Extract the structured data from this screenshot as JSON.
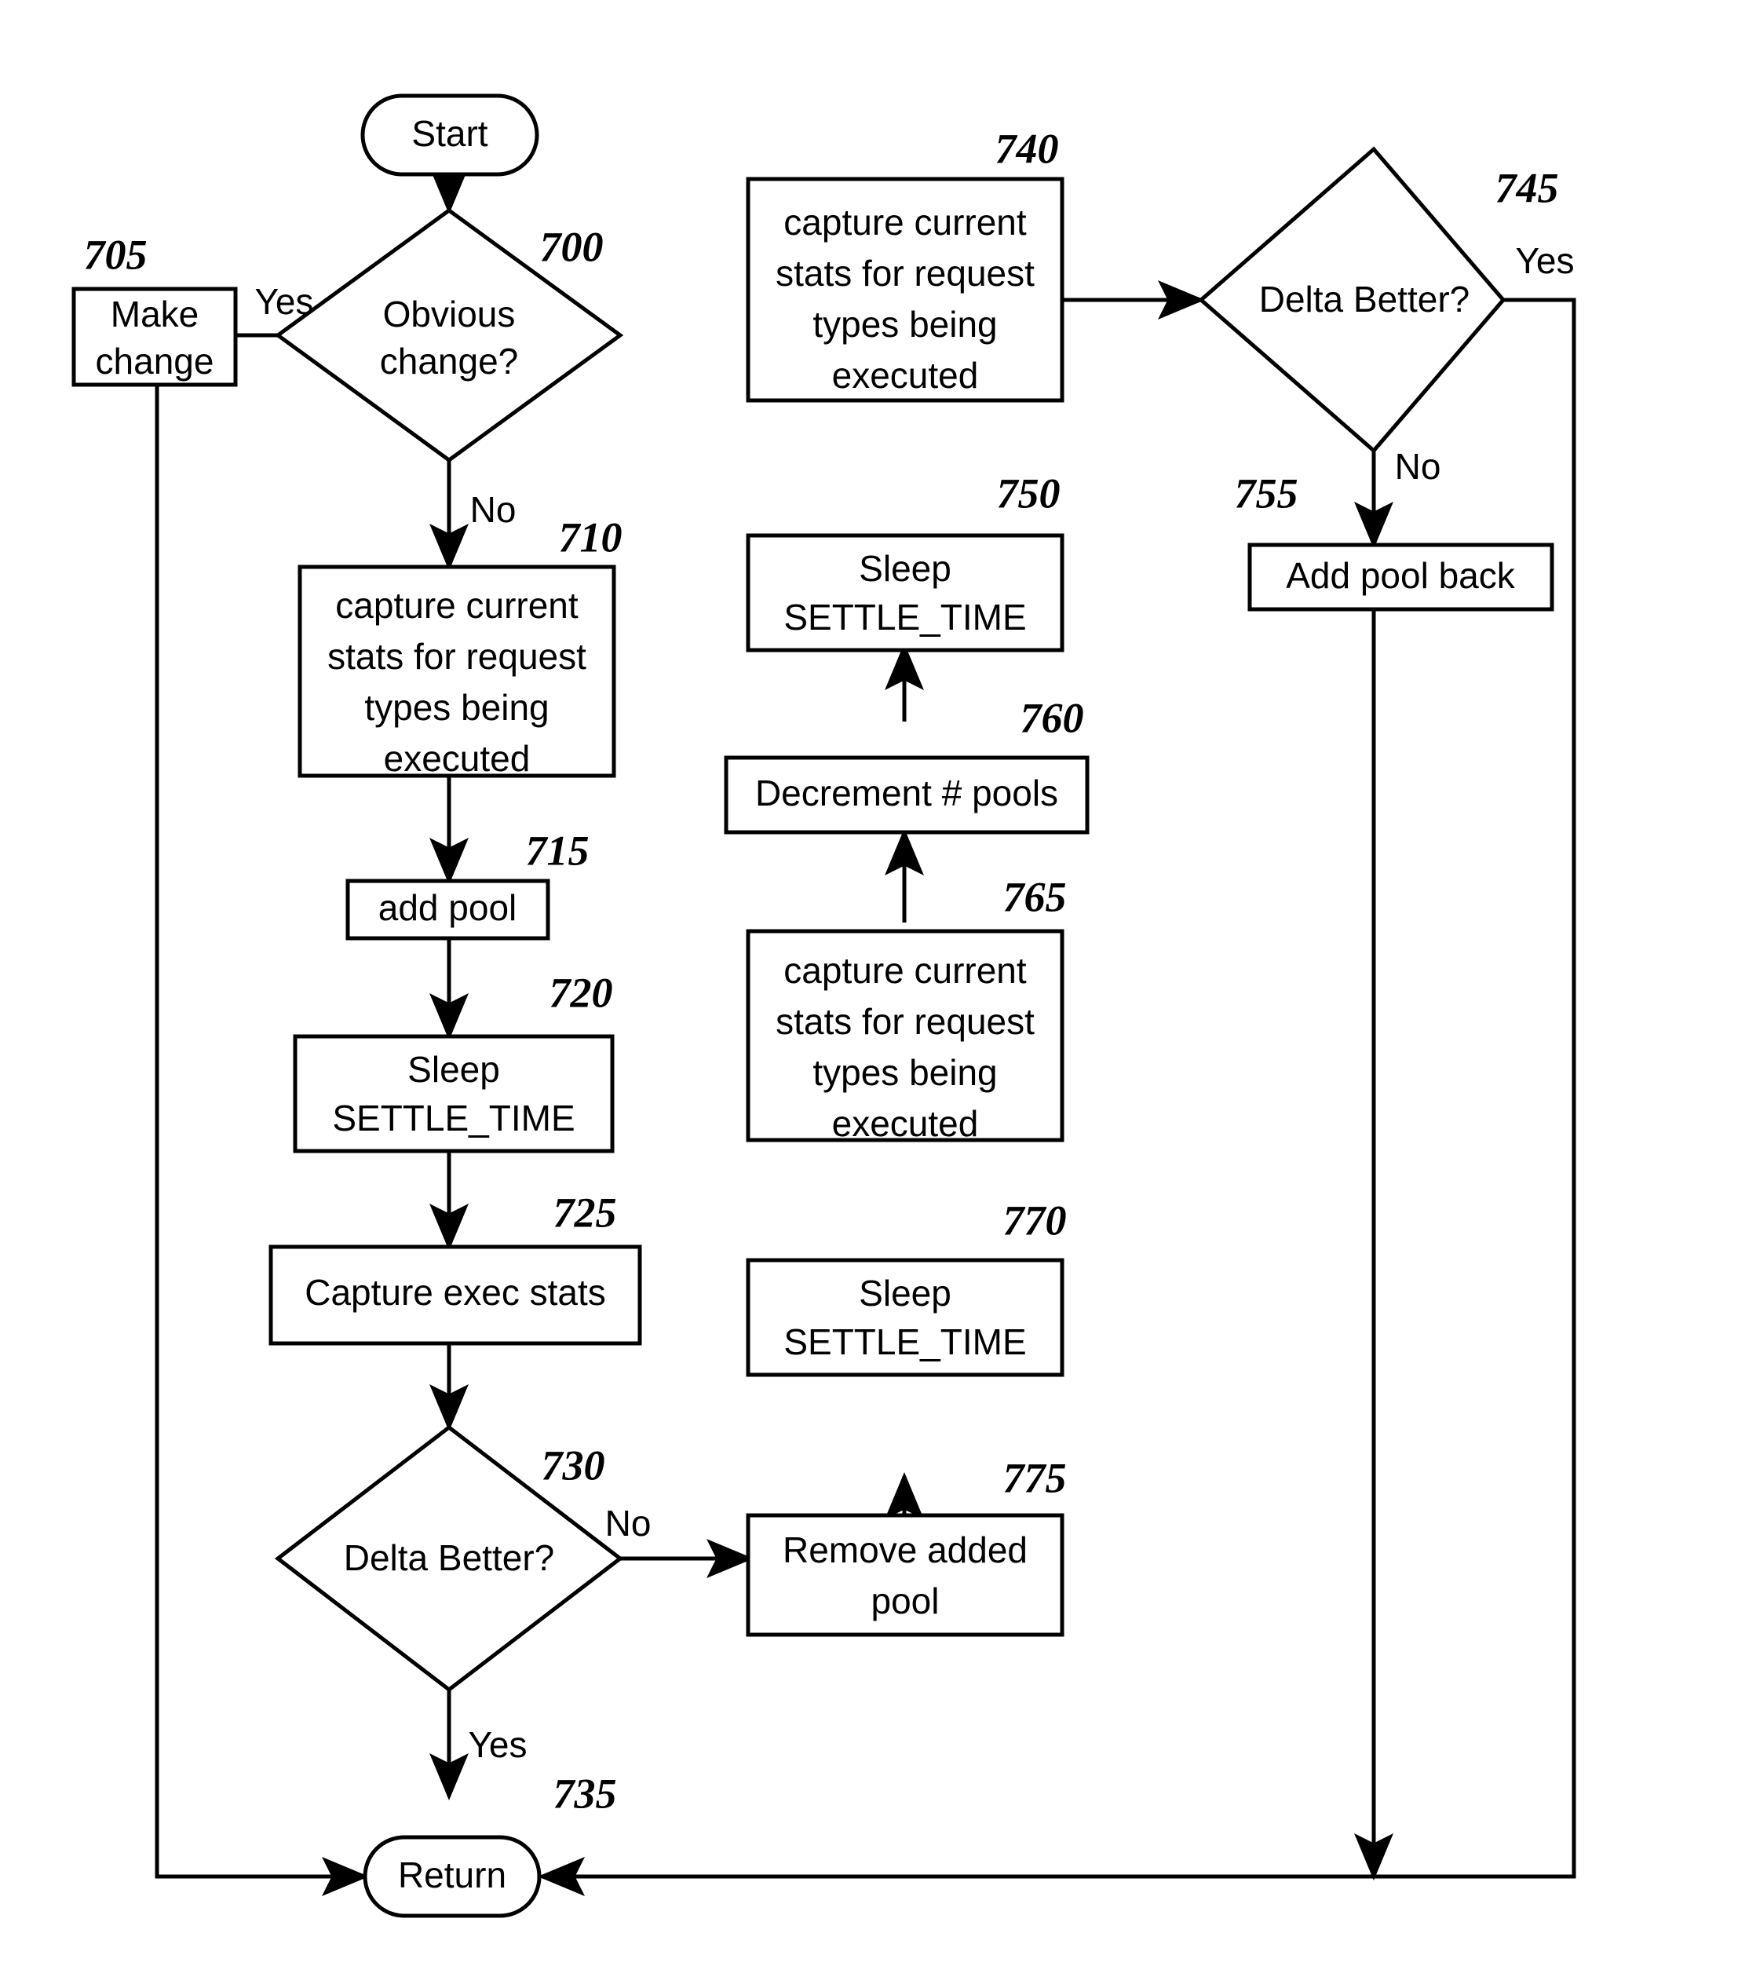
{
  "diagram": {
    "title": "Pool tuning flowchart",
    "stroke_color": "#000000",
    "fill_color": "#ffffff",
    "nodes": [
      {
        "id": "start",
        "ref": "",
        "shape": "terminator",
        "lines": [
          "Start"
        ]
      },
      {
        "id": "n700",
        "ref": "700",
        "shape": "decision",
        "lines": [
          "Obvious",
          "change?"
        ]
      },
      {
        "id": "n705",
        "ref": "705",
        "shape": "process",
        "lines": [
          "Make",
          "change"
        ]
      },
      {
        "id": "n710",
        "ref": "710",
        "shape": "process",
        "lines": [
          "capture current",
          "stats for request",
          "types being",
          "executed"
        ]
      },
      {
        "id": "n715",
        "ref": "715",
        "shape": "process",
        "lines": [
          "add pool"
        ]
      },
      {
        "id": "n720",
        "ref": "720",
        "shape": "process",
        "lines": [
          "Sleep",
          "SETTLE_TIME"
        ]
      },
      {
        "id": "n725",
        "ref": "725",
        "shape": "process",
        "lines": [
          "Capture exec stats"
        ]
      },
      {
        "id": "n730",
        "ref": "730",
        "shape": "decision",
        "lines": [
          "Delta Better?"
        ]
      },
      {
        "id": "n735",
        "ref": "735",
        "shape": "terminator",
        "lines": [
          "Return"
        ]
      },
      {
        "id": "n740",
        "ref": "740",
        "shape": "process",
        "lines": [
          "capture current",
          "stats for request",
          "types being",
          "executed"
        ]
      },
      {
        "id": "n745",
        "ref": "745",
        "shape": "decision",
        "lines": [
          "Delta Better?"
        ]
      },
      {
        "id": "n750",
        "ref": "750",
        "shape": "process",
        "lines": [
          "Sleep",
          "SETTLE_TIME"
        ]
      },
      {
        "id": "n755",
        "ref": "755",
        "shape": "process",
        "lines": [
          "Add pool back"
        ]
      },
      {
        "id": "n760",
        "ref": "760",
        "shape": "process",
        "lines": [
          "Decrement # pools"
        ]
      },
      {
        "id": "n765",
        "ref": "765",
        "shape": "process",
        "lines": [
          "capture current",
          "stats for request",
          "types being",
          "executed"
        ]
      },
      {
        "id": "n770",
        "ref": "770",
        "shape": "process",
        "lines": [
          "Sleep",
          "SETTLE_TIME"
        ]
      },
      {
        "id": "n775",
        "ref": "775",
        "shape": "process",
        "lines": [
          "Remove added",
          "pool"
        ]
      }
    ],
    "edge_labels": {
      "e700_yes": "Yes",
      "e700_no": "No",
      "e730_no": "No",
      "e730_yes": "Yes",
      "e745_yes": "Yes",
      "e745_no": "No"
    },
    "node_text": {
      "start_1": "Start",
      "n700_1": "Obvious",
      "n700_2": "change?",
      "n705_1": "Make",
      "n705_2": "change",
      "n710_1": "capture current",
      "n710_2": "stats for request",
      "n710_3": "types being",
      "n710_4": "executed",
      "n715_1": "add pool",
      "n720_1": "Sleep",
      "n720_2": "SETTLE_TIME",
      "n725_1": "Capture exec stats",
      "n730_1": "Delta Better?",
      "n735_1": "Return",
      "n740_1": "capture current",
      "n740_2": "stats for request",
      "n740_3": "types being",
      "n740_4": "executed",
      "n745_1": "Delta Better?",
      "n750_1": "Sleep",
      "n750_2": "SETTLE_TIME",
      "n755_1": "Add pool back",
      "n760_1": "Decrement # pools",
      "n765_1": "capture current",
      "n765_2": "stats for request",
      "n765_3": "types being",
      "n765_4": "executed",
      "n770_1": "Sleep",
      "n770_2": "SETTLE_TIME",
      "n775_1": "Remove added",
      "n775_2": "pool"
    },
    "ref_numbers": {
      "r700": "700",
      "r705": "705",
      "r710": "710",
      "r715": "715",
      "r720": "720",
      "r725": "725",
      "r730": "730",
      "r735": "735",
      "r740": "740",
      "r745": "745",
      "r750": "750",
      "r755": "755",
      "r760": "760",
      "r765": "765",
      "r770": "770",
      "r775": "775"
    }
  }
}
